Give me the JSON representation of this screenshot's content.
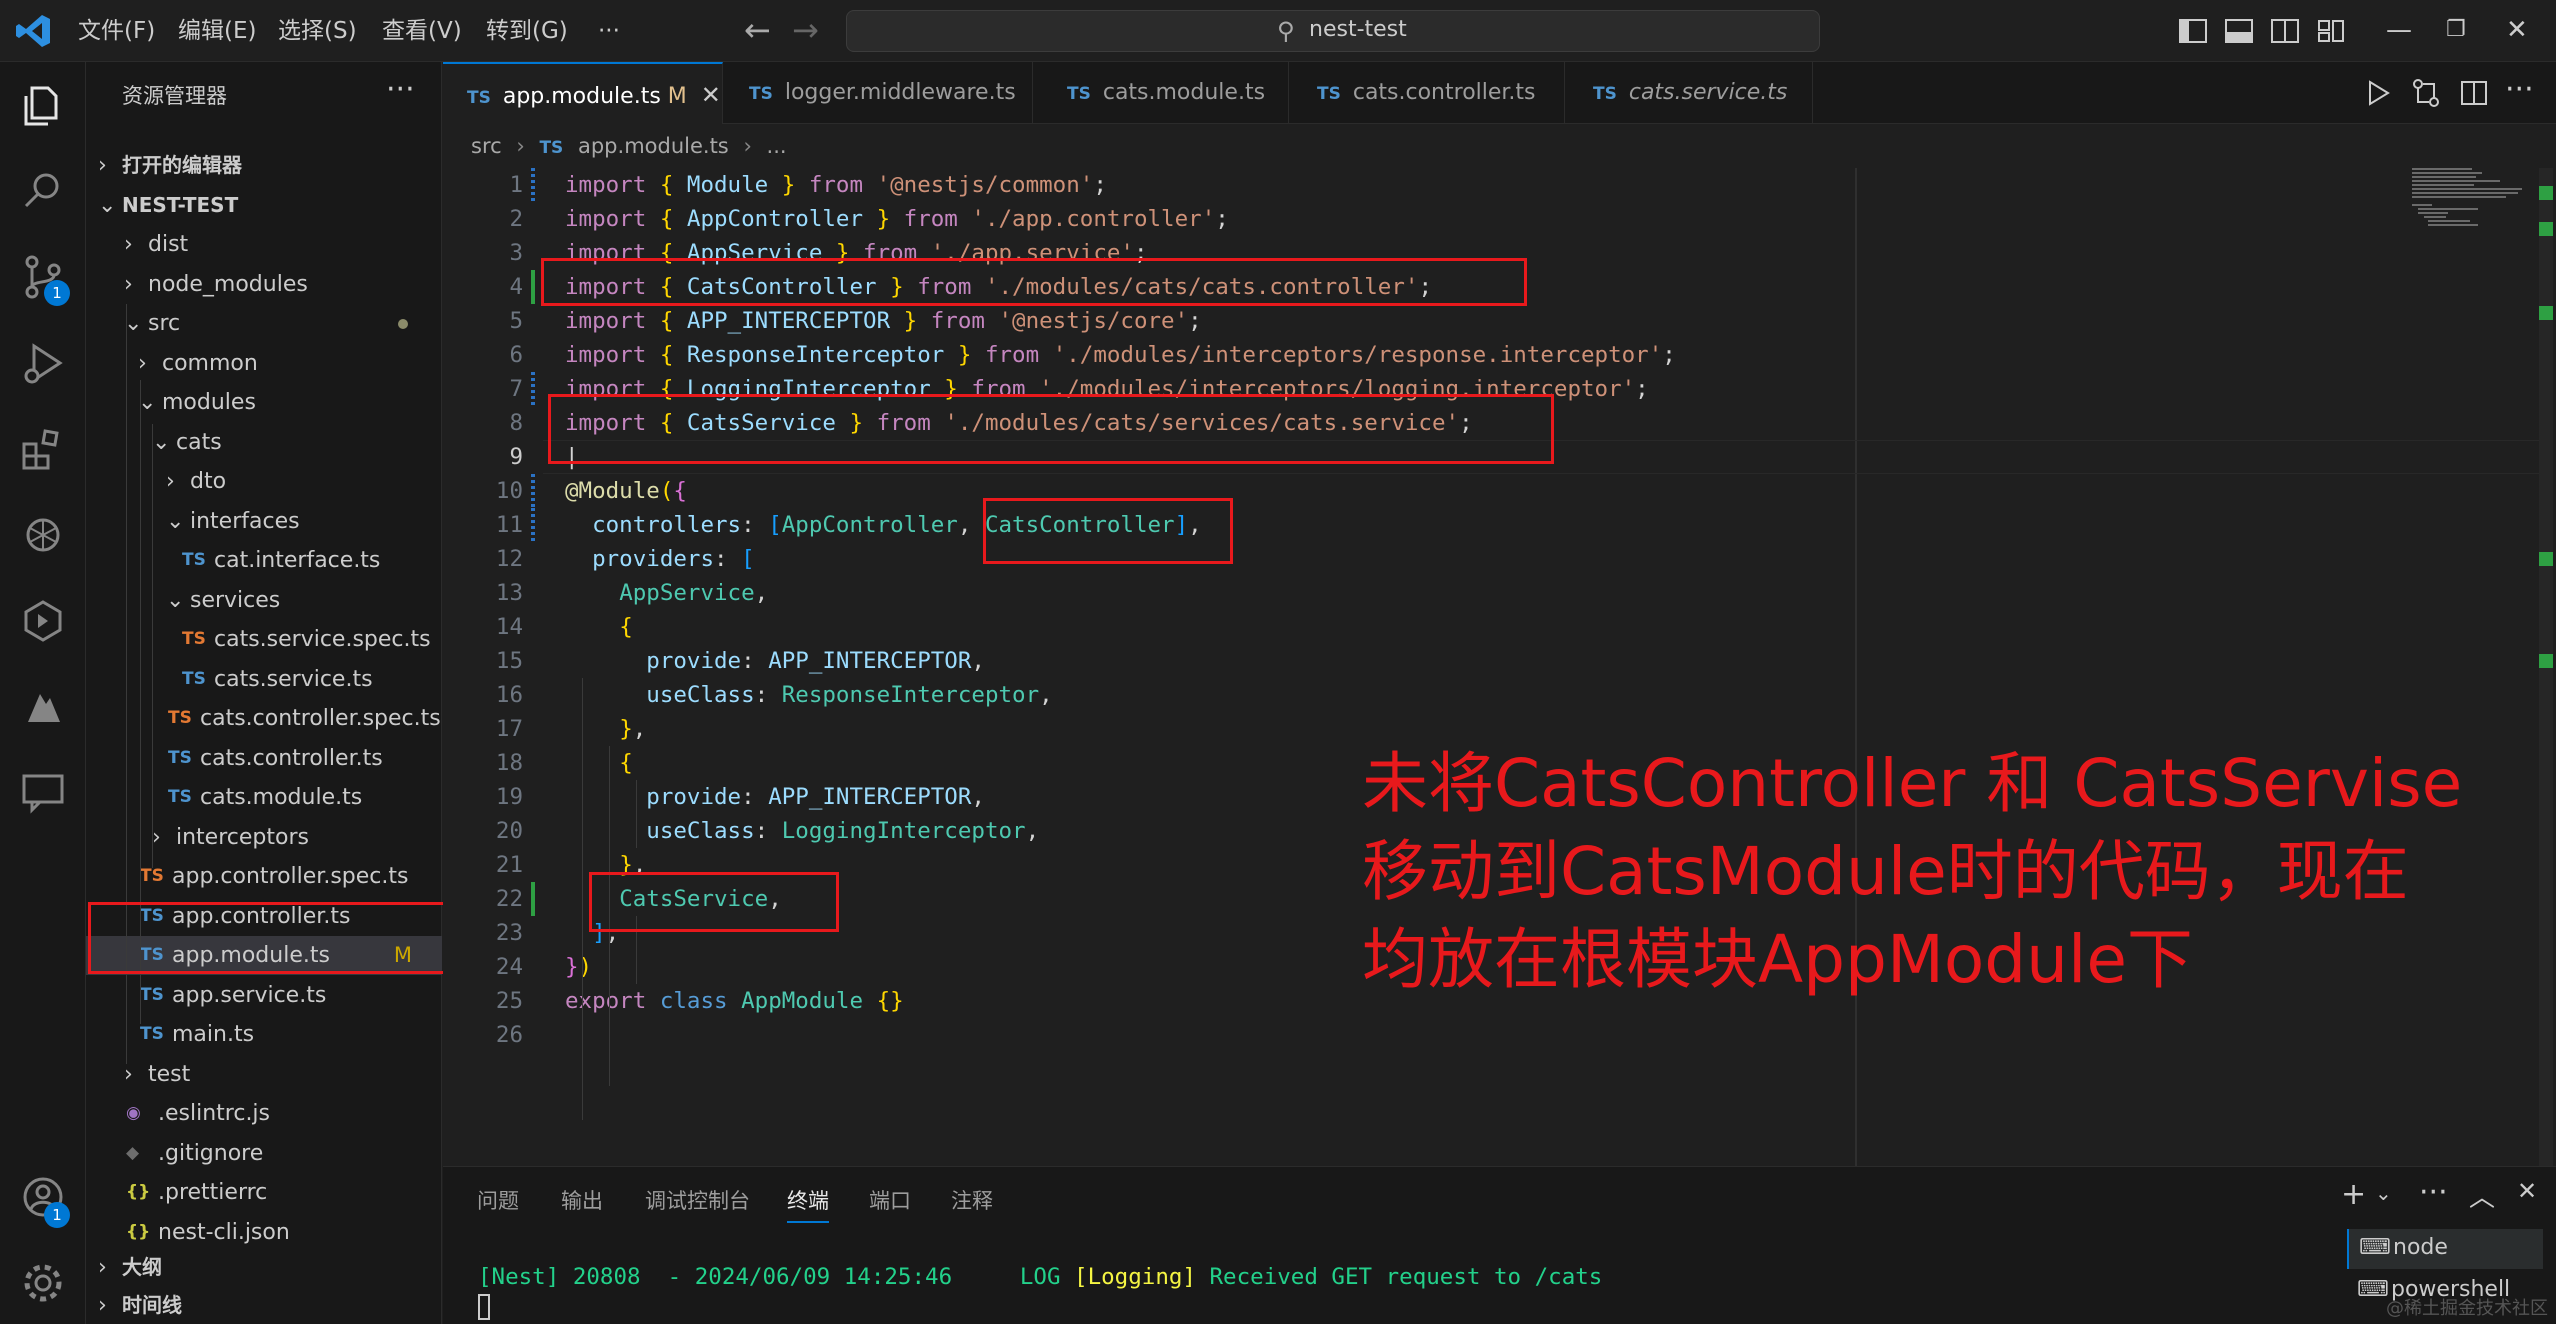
{
  "titlebar": {
    "menus": [
      "文件(F)",
      "编辑(E)",
      "选择(S)",
      "查看(V)",
      "转到(G)",
      "···"
    ],
    "search_text": "nest-test"
  },
  "activity": {
    "scm_badge": "1",
    "account_badge": "1"
  },
  "sidebar": {
    "title": "资源管理器",
    "more": "···",
    "items": [
      {
        "label": "打开的编辑器",
        "depth": 0,
        "chev": "›",
        "bold": true
      },
      {
        "label": "NEST-TEST",
        "depth": 0,
        "chev": "⌄",
        "bold": true
      },
      {
        "label": "dist",
        "depth": 1,
        "chev": "›"
      },
      {
        "label": "node_modules",
        "depth": 1,
        "chev": "›"
      },
      {
        "label": "src",
        "depth": 1,
        "chev": "⌄",
        "dot": true
      },
      {
        "label": "common",
        "depth": 2,
        "chev": "›"
      },
      {
        "label": "modules",
        "depth": 2,
        "chev": "⌄"
      },
      {
        "label": "cats",
        "depth": 3,
        "chev": "⌄"
      },
      {
        "label": "dto",
        "depth": 4,
        "chev": "›"
      },
      {
        "label": "interfaces",
        "depth": 4,
        "chev": "⌄"
      },
      {
        "label": "cat.interface.ts",
        "depth": 5,
        "ts": "TS"
      },
      {
        "label": "services",
        "depth": 4,
        "chev": "⌄"
      },
      {
        "label": "cats.service.spec.ts",
        "depth": 5,
        "ts": "TS",
        "orange": true
      },
      {
        "label": "cats.service.ts",
        "depth": 5,
        "ts": "TS"
      },
      {
        "label": "cats.controller.spec.ts",
        "depth": 4,
        "ts": "TS",
        "orange": true
      },
      {
        "label": "cats.controller.ts",
        "depth": 4,
        "ts": "TS"
      },
      {
        "label": "cats.module.ts",
        "depth": 4,
        "ts": "TS"
      },
      {
        "label": "interceptors",
        "depth": 3,
        "chev": "›"
      },
      {
        "label": "app.controller.spec.ts",
        "depth": 2,
        "ts": "TS",
        "orange": true
      },
      {
        "label": "app.controller.ts",
        "depth": 2,
        "ts": "TS"
      },
      {
        "label": "app.module.ts",
        "depth": 2,
        "ts": "TS",
        "selected": true,
        "mod": "M"
      },
      {
        "label": "app.service.ts",
        "depth": 2,
        "ts": "TS"
      },
      {
        "label": "main.ts",
        "depth": 2,
        "ts": "TS"
      },
      {
        "label": "test",
        "depth": 1,
        "chev": "›"
      },
      {
        "label": ".eslintrc.js",
        "depth": 1,
        "ts": "◉",
        "purple": true
      },
      {
        "label": ".gitignore",
        "depth": 1,
        "ts": "◆",
        "grey": true
      },
      {
        "label": ".prettierrc",
        "depth": 1,
        "ts": "{}",
        "yellow": true
      },
      {
        "label": "nest-cli.json",
        "depth": 1,
        "ts": "{}",
        "yellow": true
      }
    ],
    "outline": "大纲",
    "timeline": "时间线"
  },
  "tabs": [
    {
      "label": "app.module.ts",
      "mod": "M",
      "active": true
    },
    {
      "label": "logger.middleware.ts"
    },
    {
      "label": "cats.module.ts"
    },
    {
      "label": "cats.controller.ts"
    },
    {
      "label": "cats.service.ts",
      "italic": true
    }
  ],
  "breadcrumb": {
    "folder": "src",
    "file": "app.module.ts",
    "rest": "..."
  },
  "code": {
    "lines": [
      [
        [
          "k",
          "import "
        ],
        [
          "y",
          "{ "
        ],
        [
          "v",
          "Module"
        ],
        [
          "y",
          " }"
        ],
        [
          "k",
          " from "
        ],
        [
          "s",
          "'@nestjs/common'"
        ],
        [
          "",
          "; "
        ]
      ],
      [
        [
          "k",
          "import "
        ],
        [
          "y",
          "{ "
        ],
        [
          "v",
          "AppController"
        ],
        [
          "y",
          " }"
        ],
        [
          "k",
          " from "
        ],
        [
          "s",
          "'./app.controller'"
        ],
        [
          "",
          ";"
        ]
      ],
      [
        [
          "k",
          "import "
        ],
        [
          "y",
          "{ "
        ],
        [
          "v",
          "AppService"
        ],
        [
          "y",
          " }"
        ],
        [
          "k",
          " from "
        ],
        [
          "s",
          "'./app.service'"
        ],
        [
          "",
          ";"
        ]
      ],
      [
        [
          "k",
          "import "
        ],
        [
          "y",
          "{ "
        ],
        [
          "v",
          "CatsController"
        ],
        [
          "y",
          " }"
        ],
        [
          "k",
          " from "
        ],
        [
          "s",
          "'./modules/cats/cats.controller'"
        ],
        [
          "",
          ";"
        ]
      ],
      [
        [
          "k",
          "import "
        ],
        [
          "y",
          "{ "
        ],
        [
          "v",
          "APP_INTERCEPTOR"
        ],
        [
          "y",
          " }"
        ],
        [
          "k",
          " from "
        ],
        [
          "s",
          "'@nestjs/core'"
        ],
        [
          "",
          ";"
        ]
      ],
      [
        [
          "k",
          "import "
        ],
        [
          "y",
          "{ "
        ],
        [
          "v",
          "ResponseInterceptor"
        ],
        [
          "y",
          " }"
        ],
        [
          "k",
          " from "
        ],
        [
          "s",
          "'./modules/interceptors/response.interceptor'"
        ],
        [
          "",
          ";"
        ]
      ],
      [
        [
          "k",
          "import "
        ],
        [
          "y",
          "{ "
        ],
        [
          "v",
          "LoggingInterceptor"
        ],
        [
          "y",
          " }"
        ],
        [
          "k",
          " from "
        ],
        [
          "s",
          "'./modules/interceptors/logging.interceptor'"
        ],
        [
          "",
          ";"
        ]
      ],
      [
        [
          "k",
          "import "
        ],
        [
          "y",
          "{ "
        ],
        [
          "v",
          "CatsService"
        ],
        [
          "y",
          " }"
        ],
        [
          "k",
          " from "
        ],
        [
          "s",
          "'./modules/cats/services/cats.service'"
        ],
        [
          "",
          ";"
        ]
      ],
      [
        [
          "",
          "|"
        ]
      ],
      [
        [
          "f",
          "@Module"
        ],
        [
          "y",
          "("
        ],
        [
          "p",
          "{"
        ]
      ],
      [
        [
          "",
          "  "
        ],
        [
          "v",
          "controllers"
        ],
        [
          "",
          ": "
        ],
        [
          "l",
          "["
        ],
        [
          "c",
          "AppController"
        ],
        [
          "",
          ", "
        ],
        [
          "c",
          "CatsController"
        ],
        [
          "l",
          "]"
        ],
        [
          "",
          ","
        ]
      ],
      [
        [
          "",
          "  "
        ],
        [
          "v",
          "providers"
        ],
        [
          "",
          ": "
        ],
        [
          "l",
          "["
        ]
      ],
      [
        [
          "",
          "    "
        ],
        [
          "c",
          "AppService"
        ],
        [
          "",
          ","
        ]
      ],
      [
        [
          "",
          "    "
        ],
        [
          "y",
          "{"
        ]
      ],
      [
        [
          "",
          "      "
        ],
        [
          "v",
          "provide"
        ],
        [
          "",
          ": "
        ],
        [
          "v",
          "APP_INTERCEPTOR"
        ],
        [
          "",
          ","
        ]
      ],
      [
        [
          "",
          "      "
        ],
        [
          "v",
          "useClass"
        ],
        [
          "",
          ": "
        ],
        [
          "c",
          "ResponseInterceptor"
        ],
        [
          "",
          ","
        ]
      ],
      [
        [
          "",
          "    "
        ],
        [
          "y",
          "}"
        ],
        [
          "",
          ","
        ]
      ],
      [
        [
          "",
          "    "
        ],
        [
          "y",
          "{"
        ]
      ],
      [
        [
          "",
          "      "
        ],
        [
          "v",
          "provide"
        ],
        [
          "",
          ": "
        ],
        [
          "v",
          "APP_INTERCEPTOR"
        ],
        [
          "",
          ","
        ]
      ],
      [
        [
          "",
          "      "
        ],
        [
          "v",
          "useClass"
        ],
        [
          "",
          ": "
        ],
        [
          "c",
          "LoggingInterceptor"
        ],
        [
          "",
          ","
        ]
      ],
      [
        [
          "",
          "    "
        ],
        [
          "y",
          "}"
        ],
        [
          "",
          ","
        ]
      ],
      [
        [
          "",
          "    "
        ],
        [
          "c",
          "CatsService"
        ],
        [
          "",
          ","
        ]
      ],
      [
        [
          "",
          "  "
        ],
        [
          "l",
          "]"
        ],
        [
          "",
          ","
        ]
      ],
      [
        [
          "p",
          "}"
        ],
        [
          "y",
          ")"
        ]
      ],
      [
        [
          "k",
          "export "
        ],
        [
          "b",
          "class "
        ],
        [
          "c",
          "AppModule "
        ],
        [
          "y",
          "{}"
        ]
      ],
      [
        [
          "",
          ""
        ]
      ]
    ]
  },
  "annotation": {
    "lines": [
      "未将CatsController 和 CatsServise",
      "移动到CatsModule时的代码，现在",
      "均放在根模块AppModule下"
    ]
  },
  "panel": {
    "tabs": [
      "问题",
      "输出",
      "调试控制台",
      "终端",
      "端口",
      "注释"
    ],
    "active_tab": "终端",
    "terminal": {
      "prefix": "[Nest] 20808  - 2024/06/09 14:25:46",
      "level": "LOG",
      "context": "[Logging]",
      "message": "Received GET request to /cats"
    },
    "terminals": [
      "node",
      "powershell"
    ]
  },
  "watermark": "@稀土掘金技术社区",
  "colors": {
    "annotation": "#e8191c",
    "accent": "#0078d4"
  }
}
